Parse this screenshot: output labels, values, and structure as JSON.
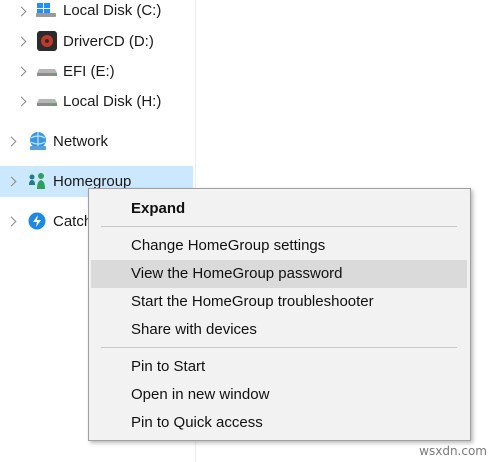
{
  "tree": {
    "items": [
      {
        "label": "Local Disk (C:)",
        "icon": "windows-drive-icon"
      },
      {
        "label": "DriverCD (D:)",
        "icon": "drivercd-icon"
      },
      {
        "label": "EFI (E:)",
        "icon": "drive-icon"
      },
      {
        "label": "Local Disk (H:)",
        "icon": "drive-icon"
      },
      {
        "label": "Network",
        "icon": "network-icon"
      },
      {
        "label": "Homegroup",
        "icon": "homegroup-icon",
        "selected": true
      },
      {
        "label": "Catch",
        "icon": "catch-icon"
      }
    ]
  },
  "context_menu": {
    "items": [
      {
        "label": "Expand",
        "bold": true
      },
      {
        "label": "Change HomeGroup settings"
      },
      {
        "label": "View the HomeGroup password",
        "highlighted": true
      },
      {
        "label": "Start the HomeGroup troubleshooter"
      },
      {
        "label": "Share with devices"
      },
      {
        "label": "Pin to Start"
      },
      {
        "label": "Open in new window"
      },
      {
        "label": "Pin to Quick access"
      }
    ]
  },
  "watermark": "wsxdn.com",
  "colors": {
    "selection": "#cce8ff",
    "menu_bg": "#f2f2f2",
    "menu_highlight": "#dadada"
  }
}
